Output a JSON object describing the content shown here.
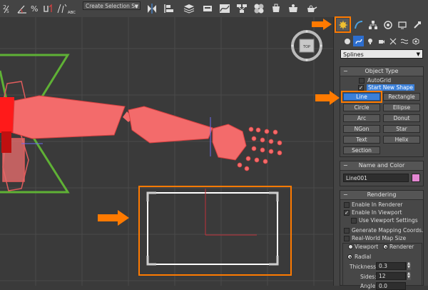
{
  "toolbar": {
    "icons": [
      "snap-2-5d-icon",
      "angle-snap-icon",
      "percent-snap-icon",
      "spinner-snap-icon",
      "edit-named-selection-icon"
    ],
    "abc_label": "ABC",
    "selection_set_placeholder": "Create Selection Se",
    "right_icons": [
      "mirror-icon",
      "align-icon",
      "layer-manager-icon",
      "ribbon-icon",
      "curve-editor-icon",
      "schematic-view-icon",
      "material-editor-icon",
      "render-setup-icon",
      "rendered-frame-icon",
      "render-icon"
    ]
  },
  "command_panel": {
    "tabs": [
      "create-tab",
      "modify-tab",
      "hierarchy-tab",
      "motion-tab",
      "display-tab",
      "utilities-tab"
    ],
    "active_tab": "create-tab",
    "sub_icons": [
      "geometry-icon",
      "shapes-icon",
      "lights-icon",
      "cameras-icon",
      "helpers-icon",
      "space-warps-icon",
      "systems-icon"
    ],
    "category": "Splines",
    "object_type": {
      "title": "Object Type",
      "autogrid": "AutoGrid",
      "start_new_shape": "Start New Shape",
      "buttons": [
        "Line",
        "Rectangle",
        "Circle",
        "Ellipse",
        "Arc",
        "Donut",
        "NGon",
        "Star",
        "Text",
        "Helix",
        "Section"
      ],
      "active_button": "Line"
    },
    "name_color": {
      "title": "Name and Color",
      "name": "Line001",
      "color": "#e387d2"
    },
    "rendering": {
      "title": "Rendering",
      "enable_in_renderer": "Enable In Renderer",
      "enable_in_viewport": "Enable In Viewport",
      "use_viewport_settings": "Use Viewport Settings",
      "generate_mapping": "Generate Mapping Coords.",
      "real_world_map": "Real-World Map Size",
      "viewport_radio": "Viewport",
      "renderer_radio": "Renderer",
      "radial": "Radial",
      "thickness_label": "Thickness:",
      "thickness_value": "0.3",
      "sides_label": "Sides:",
      "sides_value": "12",
      "angle_label": "Angle:",
      "angle_value": "0.0"
    }
  },
  "viewport": {
    "viewcube_label": "TOP"
  },
  "colors": {
    "highlight": "#ff7a00",
    "active_button": "#3a7fd8",
    "arm": "#f36b6b",
    "leg": "#5fb135"
  }
}
